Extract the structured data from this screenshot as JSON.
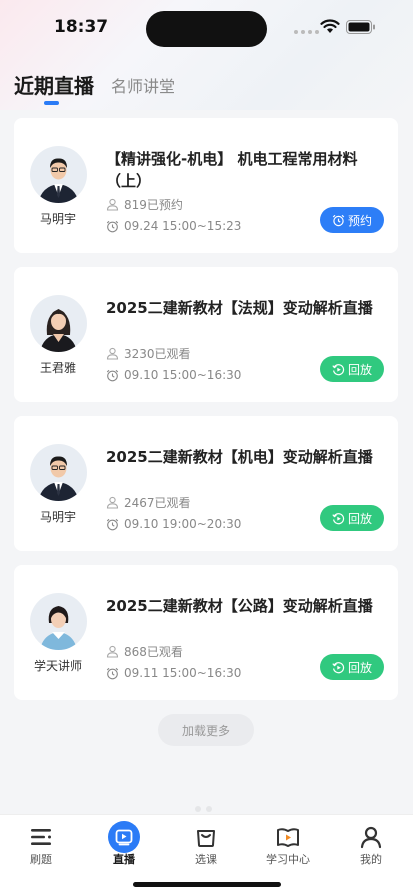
{
  "status_bar": {
    "time": "18:37"
  },
  "tabs": {
    "live": "近期直播",
    "teacher": "名师讲堂"
  },
  "cards": [
    {
      "title": "【精讲强化-机电】 机电工程常用材料（上）",
      "teacher": "马明宇",
      "stat": "819已预约",
      "time": "09.24 15:00~15:23",
      "action": "预约",
      "action_color": "#2d7ef7"
    },
    {
      "title": "2025二建新教材【法规】变动解析直播",
      "teacher": "王君雅",
      "stat": "3230已观看",
      "time": "09.10 15:00~16:30",
      "action": "回放",
      "action_color": "#30c97f"
    },
    {
      "title": "2025二建新教材【机电】变动解析直播",
      "teacher": "马明宇",
      "stat": "2467已观看",
      "time": "09.10 19:00~20:30",
      "action": "回放",
      "action_color": "#30c97f"
    },
    {
      "title": "2025二建新教材【公路】变动解析直播",
      "teacher": "学天讲师",
      "stat": "868已观看",
      "time": "09.11 15:00~16:30",
      "action": "回放",
      "action_color": "#30c97f"
    }
  ],
  "load_more": "加载更多",
  "tabbar": {
    "items": [
      {
        "label": "刷题",
        "icon": "list-icon"
      },
      {
        "label": "直播",
        "icon": "play-icon"
      },
      {
        "label": "选课",
        "icon": "shopping-bag-icon"
      },
      {
        "label": "学习中心",
        "icon": "book-play-icon"
      },
      {
        "label": "我的",
        "icon": "user-icon"
      }
    ]
  },
  "colors": {
    "accent": "#2b7bf6",
    "green": "#30c97f"
  }
}
